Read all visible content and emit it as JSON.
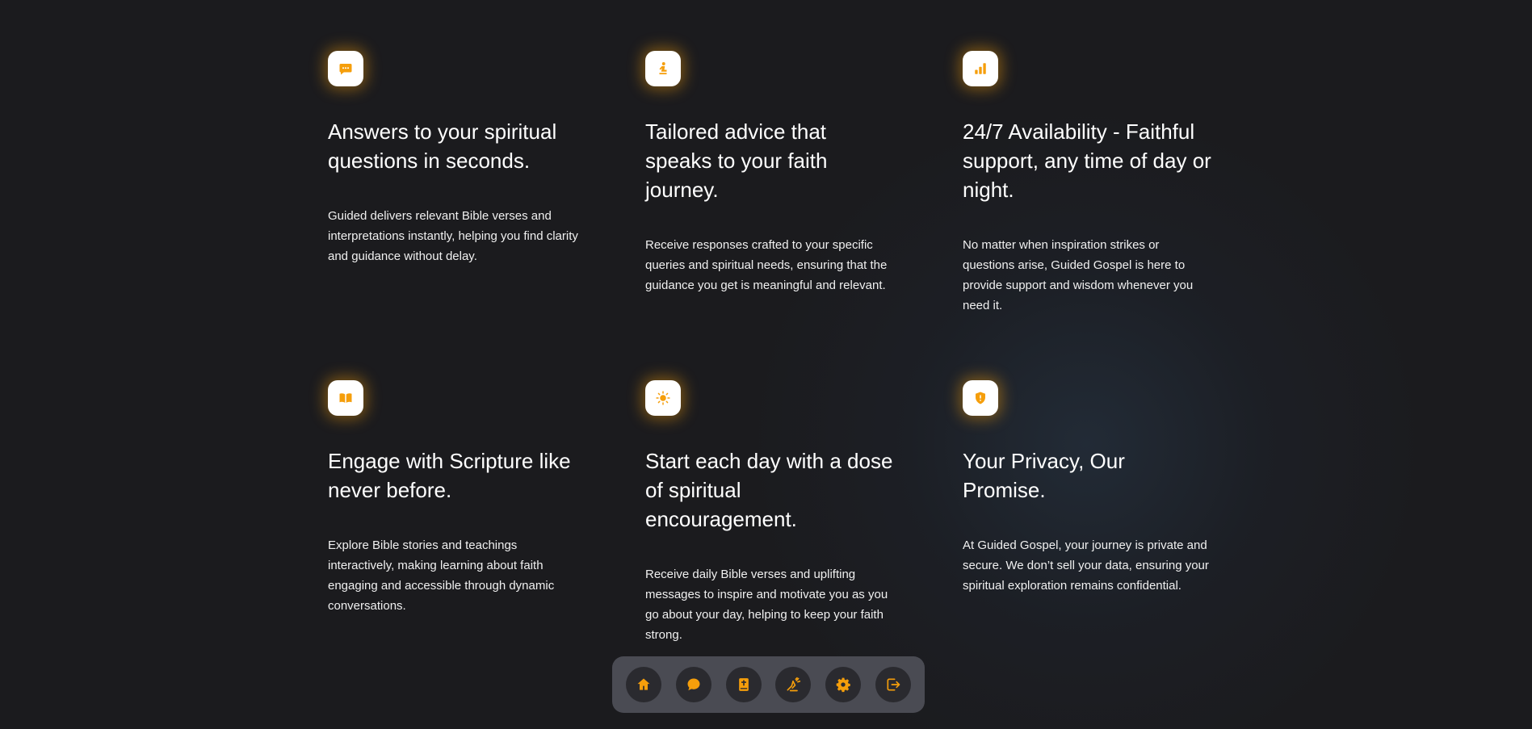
{
  "features": [
    {
      "icon": "chat-bubble-icon",
      "title": "Answers to your spiritual questions in seconds.",
      "text": "Guided delivers relevant Bible verses and interpretations instantly, helping you find clarity and guidance without delay."
    },
    {
      "icon": "praying-person-icon",
      "title": "Tailored advice that speaks to your faith journey.",
      "text": "Receive responses crafted to your specific queries and spiritual needs, ensuring that the guidance you get is meaningful and relevant."
    },
    {
      "icon": "signal-bars-icon",
      "title": "24/7 Availability - Faithful support, any time of day or night.",
      "text": "No matter when inspiration strikes or questions arise, Guided Gospel is here to provide support and wisdom whenever you need it."
    },
    {
      "icon": "open-book-icon",
      "title": "Engage with Scripture like never before.",
      "text": "Explore Bible stories and teachings interactively, making learning about faith engaging and accessible through dynamic conversations."
    },
    {
      "icon": "sun-icon",
      "title": "Start each day with a dose of spiritual encouragement.",
      "text": "Receive daily Bible verses and uplifting messages to inspire and motivate you as you go about your day, helping to keep your faith strong."
    },
    {
      "icon": "shield-icon",
      "title": "Your Privacy, Our Promise.",
      "text": "At Guided Gospel, your journey is private and secure. We don’t sell your data, ensuring your spiritual exploration remains confidential."
    }
  ],
  "dock": {
    "items": [
      "home-icon",
      "chat-icon",
      "bible-icon",
      "prayer-icon",
      "settings-icon",
      "logout-icon"
    ]
  },
  "colors": {
    "accent": "#f59e0b",
    "background": "#1b1b1e",
    "dock_background": "#4a4b53",
    "dock_button": "#2a2a2f"
  }
}
